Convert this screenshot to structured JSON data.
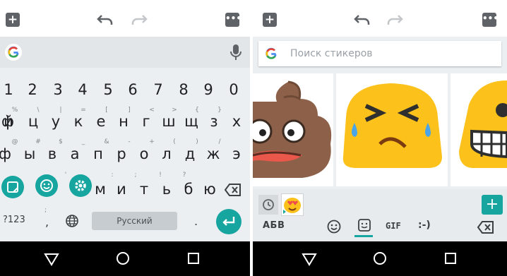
{
  "left": {
    "toolbar": {
      "add_icon": "add-icon",
      "undo_icon": "undo-icon",
      "redo_icon": "redo-icon",
      "more_icon": "more-icon"
    },
    "suggestion": {
      "g_icon": "google-g-icon",
      "mic_icon": "mic-icon"
    },
    "rows": [
      {
        "keys": [
          "1",
          "2",
          "3",
          "4",
          "5",
          "6",
          "7",
          "8",
          "9",
          "0"
        ],
        "hints": []
      },
      {
        "keys": [
          "й",
          "ц",
          "у",
          "к",
          "е",
          "н",
          "г",
          "ш",
          "щ",
          "з",
          "х"
        ],
        "hints": [
          "%",
          "\\",
          "|",
          "=",
          "[",
          "]",
          "<",
          ">",
          "{",
          "}"
        ]
      },
      {
        "keys": [
          "ф",
          "ы",
          "в",
          "а",
          "п",
          "р",
          "о",
          "л",
          "д",
          "ж",
          "э"
        ],
        "hints": [
          "@",
          "#",
          "$",
          "_",
          "&",
          "-",
          "+",
          "(",
          ")",
          "/"
        ]
      },
      {
        "keys": [
          "м",
          "и",
          "т",
          "ь",
          "б",
          "ю"
        ],
        "hints": [
          "'",
          ":",
          ";",
          "!",
          "?"
        ]
      }
    ],
    "bottom": {
      "symbols_label": "?123",
      "comma_label": ",",
      "comma_hint": ";",
      "period_label": ".",
      "space_label": "Русский",
      "globe_icon": "globe-icon",
      "enter_icon": "enter-icon",
      "backspace_icon": "backspace-icon"
    },
    "popup_icons": [
      "sticker-icon",
      "emoji-icon",
      "settings-icon"
    ],
    "nav": {
      "back": "back-icon",
      "home": "home-icon",
      "recents": "recents-icon"
    }
  },
  "right": {
    "search": {
      "placeholder": "Поиск стикеров"
    },
    "stickers": [
      "poop-sticker",
      "squinting-face-sticker",
      "grimacing-face-sticker"
    ],
    "strip": {
      "recent_icon": "clock-icon",
      "recent_sticker": "heart-eyes-sticker",
      "add_icon": "add-icon"
    },
    "tabs": {
      "abc_label": "АБВ",
      "emoji_icon": "emoji-icon",
      "sticker_icon": "sticker-icon",
      "gif_label": "GIF",
      "emoticon_label": ":-)",
      "backspace_icon": "backspace-icon"
    },
    "nav": {
      "back": "back-icon",
      "home": "home-icon",
      "recents": "recents-icon"
    }
  },
  "colors": {
    "accent": "#17a5a0",
    "keyboard_bg": "#eceff1",
    "key_text": "#202124"
  }
}
